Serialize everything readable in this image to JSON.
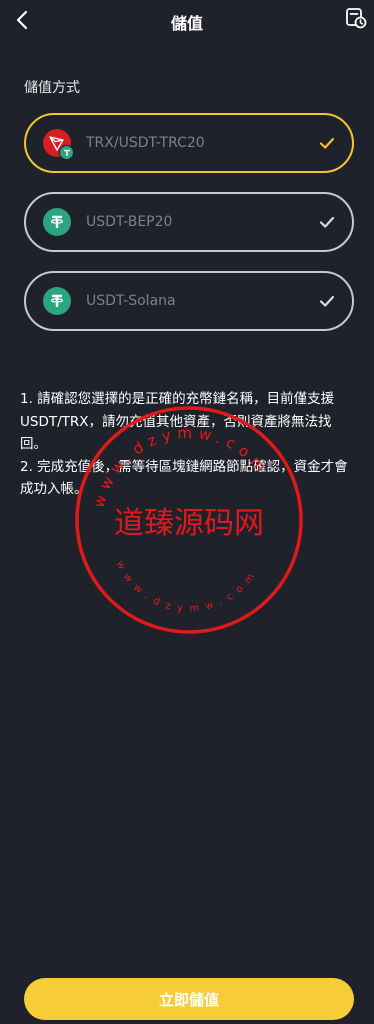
{
  "header": {
    "title": "儲值",
    "back_icon": "chevron-left-icon",
    "history_icon": "history-icon"
  },
  "section_label": "儲值方式",
  "options": [
    {
      "label": "TRX/USDT-TRC20",
      "icon": "tron-usdt-icon",
      "selected": true
    },
    {
      "label": "USDT-BEP20",
      "icon": "tether-icon",
      "selected": false
    },
    {
      "label": "USDT-Solana",
      "icon": "tether-icon",
      "selected": false
    }
  ],
  "notes": [
    "1. 請確認您選擇的是正確的充幣鏈名稱，目前僅支援USDT/TRX，請勿充值其他資產，否則資產將無法找回。",
    "2. 完成充值後，需等待區塊鏈網路節點確認，資金才會成功入帳。"
  ],
  "watermark": {
    "text": "道臻源码网",
    "ring_top": "www.dzymw.com",
    "ring_bottom": "www.dzymw.com"
  },
  "cta_label": "立即儲值",
  "colors": {
    "background": "#1f222b",
    "accent": "#f6cd36",
    "selected_border": "#f4c531",
    "tron_red": "#d41f22",
    "tether_green": "#2aa57e",
    "watermark_red": "#e0191b"
  }
}
